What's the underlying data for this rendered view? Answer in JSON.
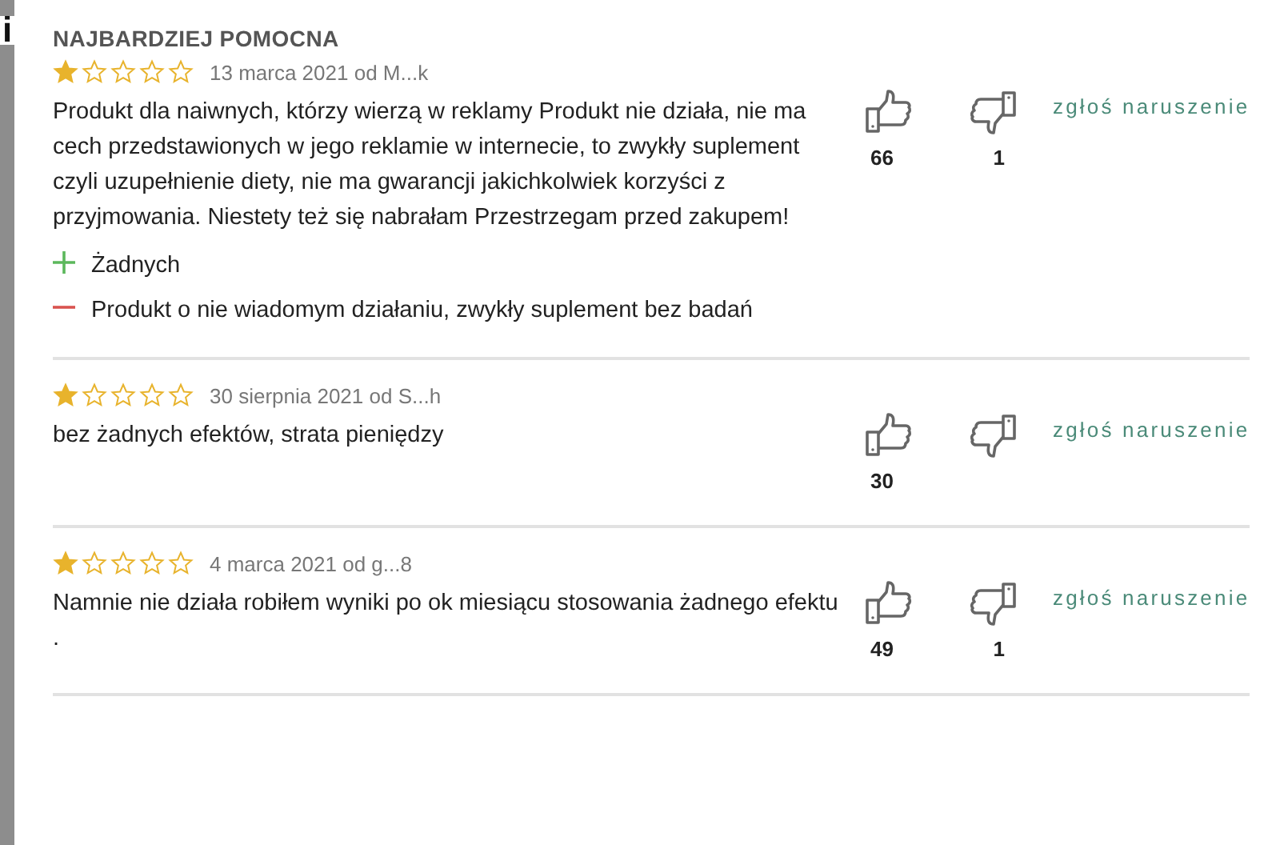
{
  "edge_text": "i",
  "section_title": "NAJBARDZIEJ POMOCNA",
  "reviews": [
    {
      "stars": 1,
      "meta": "13 marca 2021 od M...k",
      "text": "Produkt dla naiwnych, którzy wierzą w reklamy Produkt nie działa, nie ma cech przedstawionych w jego reklamie w internecie, to zwykły suplement czyli uzupełnienie diety, nie ma gwarancji jakichkolwiek korzyści z przyjmowania. Niestety też się nabrałam Przestrzegam przed zakupem!",
      "pros": [
        "Żadnych"
      ],
      "cons": [
        "Produkt o nie wiadomym działaniu, zwykły suplement bez badań"
      ],
      "likes": "66",
      "dislikes": "1",
      "report": "zgłoś naruszenie"
    },
    {
      "stars": 1,
      "meta": "30 sierpnia 2021 od S...h",
      "text": "bez żadnych efektów, strata pieniędzy",
      "likes": "30",
      "report": "zgłoś naruszenie"
    },
    {
      "stars": 1,
      "meta": "4 marca 2021 od g...8",
      "text": "Namnie nie działa robiłem wyniki po ok miesiącu stosowania żadnego efektu .",
      "likes": "49",
      "dislikes": "1",
      "report": "zgłoś naruszenie"
    }
  ]
}
